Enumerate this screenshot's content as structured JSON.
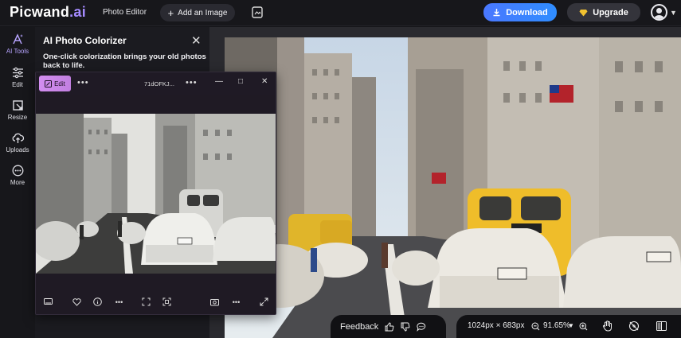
{
  "topbar": {
    "logo_main": "Picwand",
    "logo_suffix": ".ai",
    "nav_label": "Photo Editor",
    "add_image_label": "Add an Image",
    "download_label": "Download",
    "upgrade_label": "Upgrade"
  },
  "rail": {
    "items": [
      {
        "label": "AI Tools",
        "icon": "ai-tools-icon"
      },
      {
        "label": "Edit",
        "icon": "sliders-icon"
      },
      {
        "label": "Resize",
        "icon": "crop-icon"
      },
      {
        "label": "Uploads",
        "icon": "cloud-upload-icon"
      },
      {
        "label": "More",
        "icon": "more-icon"
      }
    ]
  },
  "panel": {
    "title": "AI Photo Colorizer",
    "description": "One-click colorization brings your old photos back to life."
  },
  "viewer": {
    "edit_label": "Edit",
    "filename": "71dOFKJ..."
  },
  "bottom": {
    "feedback_label": "Feedback",
    "dimensions": "1024px × 683px",
    "zoom": "91.65%"
  },
  "colors": {
    "accent_blue": "#3b82f6",
    "accent_purple": "#a58bff",
    "edit_pink": "#d38ef0",
    "background": "#141418"
  }
}
